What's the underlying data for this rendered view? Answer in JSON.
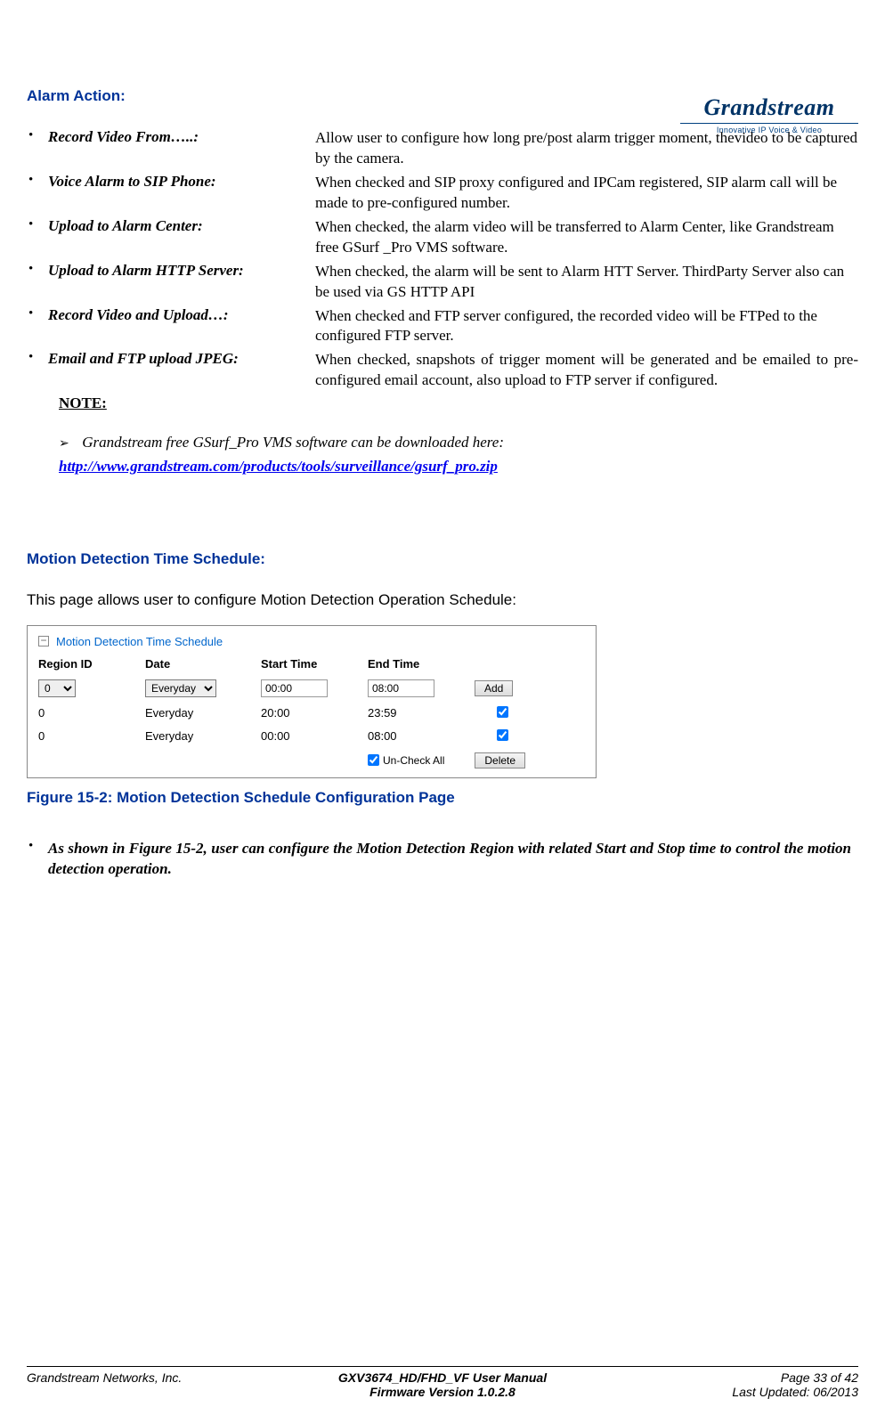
{
  "logo": {
    "main": "Grandstream",
    "sub": "Innovative IP Voice & Video"
  },
  "section1_title": "Alarm Action:",
  "actions": [
    {
      "label": "Record Video From…..:",
      "desc": "Allow user to configure how long pre/post alarm trigger moment, thevideo to be captured by the camera."
    },
    {
      "label": "Voice Alarm to SIP Phone:",
      "desc": "When checked and SIP proxy configured and IPCam registered, SIP alarm call will be made to pre-configured number."
    },
    {
      "label": "Upload to Alarm Center:",
      "desc": "When checked, the alarm video will be transferred to Alarm Center, like Grandstream free GSurf _Pro VMS software."
    },
    {
      "label": "Upload to Alarm HTTP Server:",
      "desc": "When checked, the alarm will be sent to Alarm HTT Server. ThirdParty Server also can be used via GS HTTP API"
    },
    {
      "label": "Record Video and Upload…:",
      "desc": "When checked and FTP server configured, the recorded video will  be FTPed to the configured FTP server."
    },
    {
      "label": "Email and FTP upload JPEG:",
      "desc": "When checked, snapshots of trigger moment will be generated and be emailed to pre-configured email account, also upload to FTP server if configured."
    }
  ],
  "note_label": "NOTE:",
  "note_text": "Grandstream  free GSurf_Pro VMS software can be downloaded here:",
  "download_url": "http://www.grandstream.com/products/tools/surveillance/gsurf_pro.zip",
  "section2_title": "Motion Detection Time Schedule:",
  "section2_intro": "This page allows user to configure Motion Detection Operation Schedule:",
  "screenshot": {
    "title": "Motion Detection Time Schedule",
    "headers": {
      "col1": "Region ID",
      "col2": "Date",
      "col3": "Start Time",
      "col4": "End Time"
    },
    "input_row": {
      "region": "0",
      "date": "Everyday",
      "start": "00:00",
      "end": "08:00",
      "button": "Add"
    },
    "rows": [
      {
        "region": "0",
        "date": "Everyday",
        "start": "20:00",
        "end": "23:59",
        "checked": true
      },
      {
        "region": "0",
        "date": "Everyday",
        "start": "00:00",
        "end": "08:00",
        "checked": true
      }
    ],
    "uncheck_label": "Un-Check All",
    "delete_btn": "Delete"
  },
  "figure_caption": "Figure 15-2:  Motion Detection Schedule Configuration Page",
  "figure_note": "As shown in Figure 15-2, user can configure the Motion Detection Region with related Start and Stop time to control the motion detection operation.",
  "footer": {
    "company": "Grandstream Networks, Inc.",
    "manual": "GXV3674_HD/FHD_VF User Manual",
    "firmware": "Firmware Version 1.0.2.8",
    "page": "Page 33 of 42",
    "updated": "Last Updated: 06/2013"
  }
}
